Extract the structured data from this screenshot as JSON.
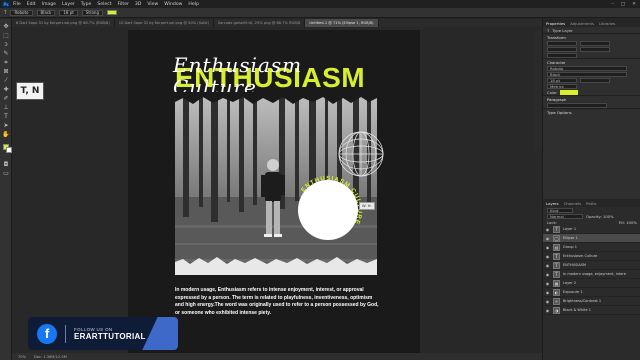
{
  "menu": {
    "app_icon": "Ps",
    "items": [
      "File",
      "Edit",
      "Image",
      "Layer",
      "Type",
      "Select",
      "Filter",
      "3D",
      "View",
      "Window",
      "Help"
    ],
    "window_buttons": [
      "–",
      "□",
      "✕"
    ]
  },
  "options": {
    "tool_glyph": "T",
    "font_family": "Roboto",
    "font_style": "Black",
    "font_size": "18 pt",
    "anti_alias": "Strong",
    "text_color": "#d8ee2f"
  },
  "tabs": [
    {
      "label": "8 Dart Sape 31 by Kerpert.sel.png @ 66.7% (RGB/8)",
      "active": false
    },
    {
      "label": "10 Dart Sape 31 by Kerpert.sel.png @ 50% (Solid)",
      "active": false
    },
    {
      "label": "Sarcade galsell9.ttl, 25% png @ 66.7% RGB/8",
      "active": false
    },
    {
      "label": "Untitled-1 @ 71% (Ellipse 1, RGB/8)",
      "active": true
    }
  ],
  "tooltip": "T, N",
  "artboard": {
    "headline": "ENTHUSIASM",
    "script_title": "Enthusiasm Culture",
    "badge_text": "ENTHUSIASM CULTURE",
    "size_chip": "W: H:",
    "body": "In modern usage, Enthusiasm refers to intense enjoyment, interest, or approval expressed by a person. The term is related to playfulness, inventiveness, optimism and high energy.The word was originally used to refer to a person possessed by God, or someone who exhibited intense piety."
  },
  "status": {
    "zoom": "70%",
    "doc": "Doc: 1.36M/12.5M"
  },
  "follow": {
    "icon": "f",
    "line1": "FOLLOW US ON",
    "line2": "ERARTTUTORIAL"
  },
  "properties": {
    "tabs": [
      "Properties",
      "Adjustments",
      "Libraries"
    ],
    "layer_kind": "Type Layer",
    "transform_label": "Transform",
    "character_label": "Character",
    "font": "Roboto",
    "style": "Black",
    "size": "18 pt",
    "tracking": "Metrics",
    "color_label": "Color",
    "paragraph_label": "Paragraph",
    "type_options_label": "Type Options"
  },
  "layers_panel": {
    "tabs": [
      "Layers",
      "Channels",
      "Paths"
    ],
    "kind_filter": "Kind",
    "blend_mode": "Normal",
    "opacity": "Opacity: 100%",
    "lock": "Lock:",
    "fill": "Fill: 100%",
    "rows": [
      {
        "name": "Layer 1",
        "thumb": "T",
        "selected": false
      },
      {
        "name": "Ellipse 1",
        "thumb": "◯",
        "selected": true
      },
      {
        "name": "Group 1",
        "thumb": "▤",
        "selected": false
      },
      {
        "name": "Enthusiasm Culture",
        "thumb": "T",
        "selected": false
      },
      {
        "name": "ENTHUSIASM",
        "thumb": "T",
        "selected": false
      },
      {
        "name": "In modern usage, enjoyment, intere",
        "thumb": "T",
        "selected": false
      },
      {
        "name": "Layer 2",
        "thumb": "▦",
        "selected": false
      },
      {
        "name": "Exposure 1",
        "thumb": "◐",
        "selected": false
      },
      {
        "name": "Brightness/Contrast 1",
        "thumb": "☼",
        "selected": false
      },
      {
        "name": "Black & White 1",
        "thumb": "◑",
        "selected": false
      }
    ]
  },
  "colors": {
    "accent": "#d8ee2f",
    "panel": "#2f2f2f",
    "facebook": "#1877f2",
    "follow_bg": "#0e1c38"
  }
}
